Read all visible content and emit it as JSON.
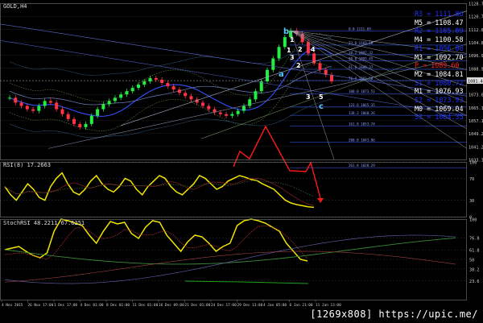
{
  "window": {
    "title": "GOLD,H4"
  },
  "main_panel": {
    "price_labels": [
      "1128.70",
      "1120.75",
      "1112.80",
      "1104.85",
      "1096.90",
      "1088.95",
      "1081.00",
      "1073.05",
      "1065.10",
      "1057.15",
      "1049.20",
      "1041.25",
      "1033.30"
    ],
    "last_price": "1081.47",
    "fib_levels": [
      "0.0 1111.69",
      "23.6 1103.18",
      "38.2 1097.32",
      "50.0 1093.45",
      "61.8 1088.37",
      "76.4 1081.50",
      "100.0 1073.51",
      "123.6 1065.35",
      "138.2 1060.26",
      "161.8 1053.74",
      "200.0 1043.86",
      "261.8 1028.29"
    ],
    "wave_labels": [
      "b",
      "a",
      "c",
      "1",
      "2",
      "3",
      "4",
      "5",
      "3",
      "2",
      "1"
    ],
    "pivots": [
      {
        "name": "R3",
        "value": "1111.86",
        "color": "#2233ff"
      },
      {
        "name": "M5",
        "value": "1108.47",
        "color": "#ffffff"
      },
      {
        "name": "R2",
        "value": "1105.09",
        "color": "#2233ff"
      },
      {
        "name": "M4",
        "value": "1100.58",
        "color": "#ffffff"
      },
      {
        "name": "R1",
        "value": "1096.08",
        "color": "#2233ff"
      },
      {
        "name": "M3",
        "value": "1092.70",
        "color": "#ffffff"
      },
      {
        "name": "P",
        "value": "1089.60",
        "color": "#ff2020"
      },
      {
        "name": "M2",
        "value": "1084.81",
        "color": "#ffffff"
      },
      {
        "name": "S1",
        "value": "1080.72",
        "color": "#2233ff"
      },
      {
        "name": "M1",
        "value": "1076.93",
        "color": "#ffffff"
      },
      {
        "name": "S2",
        "value": "1073.93",
        "color": "#2233ff"
      },
      {
        "name": "M0",
        "value": "1069.04",
        "color": "#ffffff"
      },
      {
        "name": "S3",
        "value": "1064.35",
        "color": "#2233ff"
      }
    ]
  },
  "rsi_panel": {
    "title": "RSI(8) 17.2663",
    "scale": [
      "100",
      "70",
      "30",
      "0"
    ]
  },
  "stoch_panel": {
    "title": "StochRSI 48.2211 67.6251",
    "scale": [
      "100",
      "76.8",
      "61.8",
      "50",
      "38.2",
      "23.6"
    ]
  },
  "time_axis": [
    "4 Nov 2015",
    "26 Nov 17:00",
    "1 Dec 17:00",
    "4 Dec 01:00",
    "8 Dec 01:00",
    "11 Dec 01:00",
    "16 Dec 09:00",
    "21 Dec 01:00",
    "24 Dec 17:00",
    "29 Dec 13:00",
    "4 Jan 05:00",
    "6 Jan 21:00",
    "11 Jan 13:00"
  ],
  "watermark": "[1269x808] https://upic.me/",
  "chart_data": [
    {
      "type": "line",
      "title": "GOLD,H4",
      "series": [
        {
          "name": "price",
          "values": [
            1071,
            1068,
            1066,
            1064,
            1063,
            1066,
            1069,
            1068,
            1064,
            1061,
            1058,
            1055,
            1053,
            1055,
            1060,
            1064,
            1067,
            1069,
            1071,
            1073,
            1075,
            1077,
            1079,
            1081,
            1083,
            1082,
            1080,
            1078,
            1076,
            1074,
            1072,
            1070,
            1068,
            1066,
            1064,
            1062,
            1061,
            1060,
            1061,
            1063,
            1066,
            1070,
            1075,
            1081,
            1088,
            1095,
            1102,
            1108,
            1112,
            1110,
            1105,
            1098,
            1092,
            1088,
            1085,
            1081
          ]
        }
      ],
      "ylim": [
        1033.3,
        1128.7
      ]
    },
    {
      "type": "line",
      "title": "RSI(8) 17.2663",
      "series": [
        {
          "name": "RSI(8)",
          "values": [
            55,
            40,
            30,
            45,
            60,
            50,
            35,
            30,
            55,
            70,
            80,
            60,
            45,
            40,
            50,
            65,
            75,
            60,
            50,
            45,
            55,
            70,
            65,
            50,
            40,
            55,
            65,
            75,
            70,
            55,
            45,
            40,
            50,
            60,
            75,
            70,
            60,
            50,
            55,
            65,
            70,
            75,
            72,
            68,
            66,
            60,
            55,
            50,
            40,
            30,
            25,
            22,
            20,
            18,
            17
          ]
        }
      ],
      "ylim": [
        0,
        100
      ]
    },
    {
      "type": "line",
      "title": "StochRSI 48.2211 67.6251",
      "series": [
        {
          "name": "StochRSI",
          "values": [
            62,
            64,
            66,
            60,
            55,
            52,
            58,
            85,
            100,
            98,
            95,
            92,
            80,
            70,
            85,
            97,
            94,
            96,
            82,
            76,
            90,
            98,
            96,
            80,
            70,
            60,
            72,
            80,
            78,
            70,
            60,
            66,
            70,
            92,
            98,
            100,
            98,
            95,
            90,
            85,
            70,
            60,
            50,
            48
          ]
        }
      ],
      "ylim": [
        0,
        100
      ]
    }
  ]
}
